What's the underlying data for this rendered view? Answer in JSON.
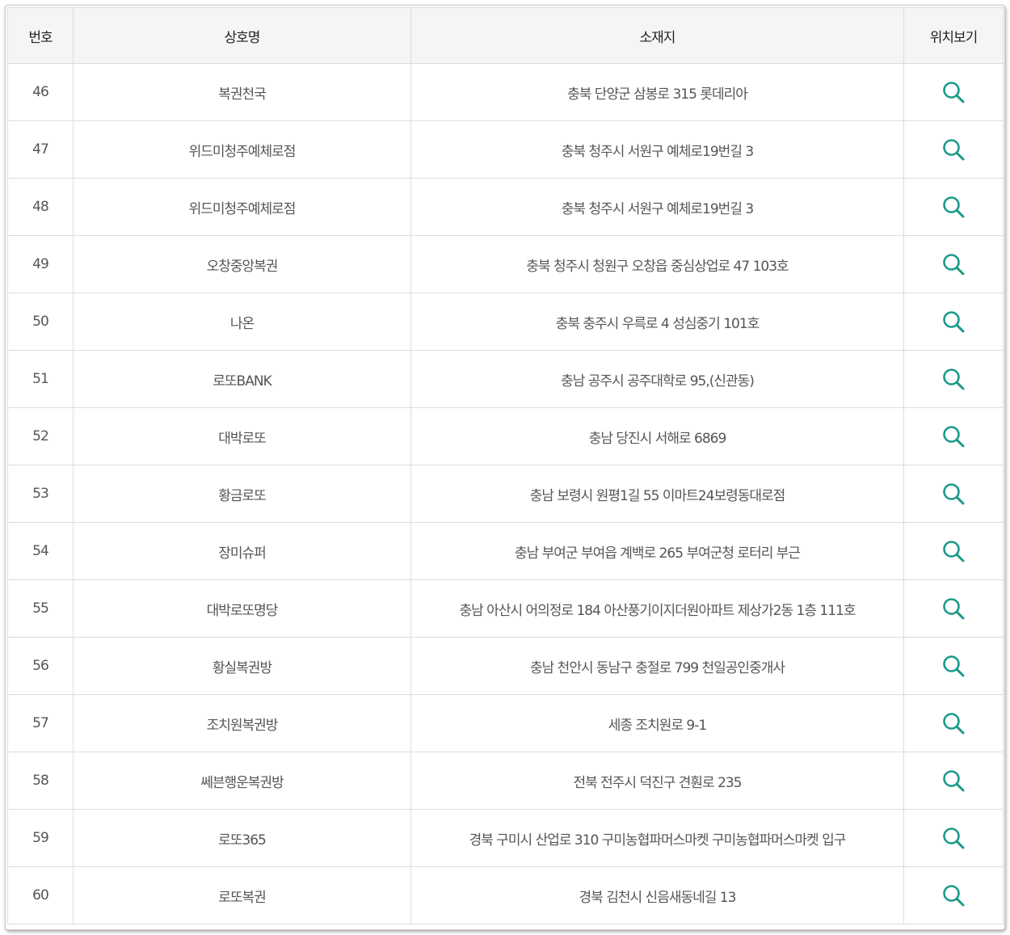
{
  "table": {
    "headers": [
      "번호",
      "상호명",
      "소재지",
      "위치보기"
    ],
    "icon": "search-icon",
    "icon_color": "#1a9a8a",
    "rows": [
      {
        "no": "46",
        "name": "복권천국",
        "address": "충북 단양군 삼봉로 315 롯데리아"
      },
      {
        "no": "47",
        "name": "위드미청주예체로점",
        "address": "충북 청주시 서원구 예체로19번길 3"
      },
      {
        "no": "48",
        "name": "위드미청주예체로점",
        "address": "충북 청주시 서원구 예체로19번길 3"
      },
      {
        "no": "49",
        "name": "오창중앙복권",
        "address": "충북 청주시 청원구 오창읍 중심상업로 47 103호"
      },
      {
        "no": "50",
        "name": "나온",
        "address": "충북 충주시 우륵로 4 성심중기 101호"
      },
      {
        "no": "51",
        "name": "로또BANK",
        "address": "충남 공주시 공주대학로 95,(신관동)"
      },
      {
        "no": "52",
        "name": "대박로또",
        "address": "충남 당진시 서해로 6869"
      },
      {
        "no": "53",
        "name": "황금로또",
        "address": "충남 보령시 원평1길 55 이마트24보령동대로점"
      },
      {
        "no": "54",
        "name": "장미슈퍼",
        "address": "충남 부여군 부여읍 계백로 265 부여군청 로터리 부근"
      },
      {
        "no": "55",
        "name": "대박로또명당",
        "address": "충남 아산시 어의정로 184 아산풍기이지더원아파트 제상가2동 1층 111호"
      },
      {
        "no": "56",
        "name": "황실복권방",
        "address": "충남 천안시 동남구 충절로 799 천일공인중개사"
      },
      {
        "no": "57",
        "name": "조치원복권방",
        "address": "세종 조치원로 9-1"
      },
      {
        "no": "58",
        "name": "쎄븐행운복권방",
        "address": "전북 전주시 덕진구 견훤로 235"
      },
      {
        "no": "59",
        "name": "로또365",
        "address": "경북 구미시 산업로 310 구미농협파머스마켓 구미농협파머스마켓 입구"
      },
      {
        "no": "60",
        "name": "로또복권",
        "address": "경북 김천시 신음새동네길 13"
      }
    ]
  }
}
